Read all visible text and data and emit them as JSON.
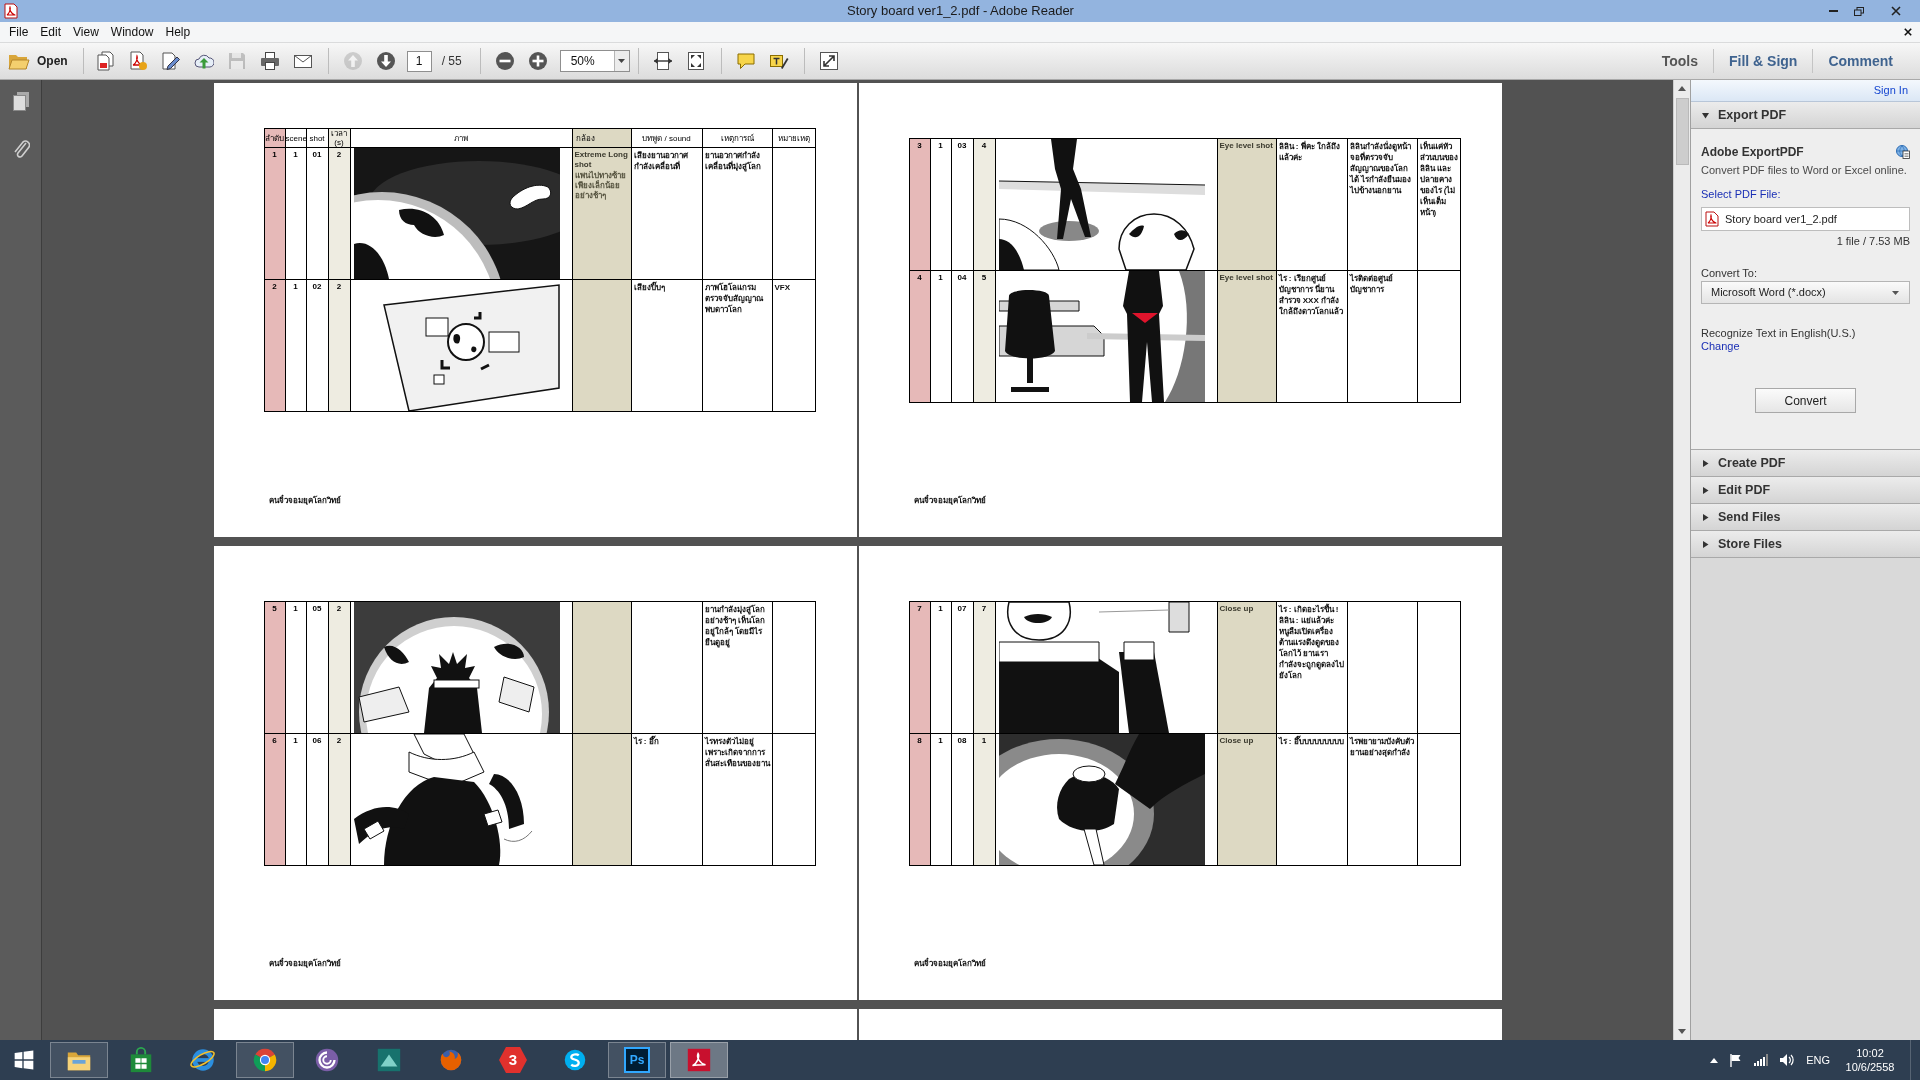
{
  "window": {
    "title": "Story board ver1_2.pdf - Adobe Reader"
  },
  "menu": [
    "File",
    "Edit",
    "View",
    "Window",
    "Help"
  ],
  "toolbar": {
    "open": "Open",
    "buttons": [
      {
        "kind": "create",
        "disabled": false
      },
      {
        "kind": "export",
        "disabled": false
      },
      {
        "kind": "edit",
        "disabled": false
      },
      {
        "kind": "upload",
        "disabled": false
      },
      {
        "kind": "save",
        "disabled": true
      },
      {
        "kind": "print",
        "disabled": false
      },
      {
        "kind": "email",
        "disabled": false
      },
      {
        "kind": "prev",
        "disabled": true
      },
      {
        "kind": "next",
        "disabled": false
      },
      {
        "kind": "zoom_out",
        "disabled": false
      },
      {
        "kind": "zoom_in",
        "disabled": false
      },
      {
        "kind": "fit_width",
        "disabled": false
      },
      {
        "kind": "fit_page",
        "disabled": false
      },
      {
        "kind": "comment",
        "disabled": false
      },
      {
        "kind": "highlight",
        "disabled": false
      },
      {
        "kind": "fullscreen",
        "disabled": false
      }
    ],
    "page": "1",
    "page_total": "/ 55",
    "zoom": "50%",
    "panes": [
      {
        "label": "Tools",
        "selected": true
      },
      {
        "label": "Fill & Sign",
        "selected": false
      },
      {
        "label": "Comment",
        "selected": false
      }
    ]
  },
  "pages": [
    {
      "header": [
        "ลำดับ",
        "scene",
        "shot",
        "เวลา (s)",
        "ภาพ",
        "กล้อง",
        "บทพูด / sound",
        "เหตุการณ์",
        "หมายเหตุ"
      ],
      "rows": [
        {
          "order": "1",
          "scene": "1",
          "shot": "01",
          "time": "2",
          "camera": "Extreme Long shot",
          "camera_note": "แพนไปทางซ้ายเพียงเล็กน้อยอย่างช้าๆ",
          "sound": "เสียงยานอวกาศกำลังเคลื่อนที่",
          "event": "ยานอวกาศกำลังเคลื่อนที่มุ่งสู่โลก"
        },
        {
          "order": "2",
          "scene": "1",
          "shot": "02",
          "time": "2",
          "sound": "เสียงปิ๊บๆ",
          "event": "ภาพโฮโลแกรมตรวจจับสัญญาณพบดาวโลก",
          "note": "VFX"
        }
      ],
      "footer": "คนจิ๋วจอมยุคโลกวิทย์"
    },
    {
      "rows": [
        {
          "order": "3",
          "scene": "1",
          "shot": "03",
          "time": "4",
          "camera": "Eye level shot",
          "sound": "ลิลิน : พี่คะ ใกล้ถึงแล้วค่ะ",
          "event": "ลิลินกำลังนั่งดูหน้าจอที่ตรวจจับสัญญาณของโลกได้ ไรกำลังยืนมองไปข้างนอกยาน",
          "note": "เห็นแค่หัวส่วนบนของลิลิน และปลายคางของไร (ไม่เห็นเต็มหน้า)"
        },
        {
          "order": "4",
          "scene": "1",
          "shot": "04",
          "time": "5",
          "camera": "Eye level shot",
          "sound": "ไร : เรียกศูนย์บัญชาการ นี่ยานสำรวจ XXX กำลังใกล้ถึงดาวโลกแล้ว",
          "event": "ไรติดต่อศูนย์บัญชาการ"
        }
      ],
      "footer": "คนจิ๋วจอมยุคโลกวิทย์"
    },
    {
      "rows": [
        {
          "order": "5",
          "scene": "1",
          "shot": "05",
          "time": "2",
          "event": "ยานกำลังมุ่งสู่โลกอย่างช้าๆ เห็นโลกอยู่ใกล้ๆ โดยมีไรยืนดูอยู่"
        },
        {
          "order": "6",
          "scene": "1",
          "shot": "06",
          "time": "2",
          "sound": "ไร : อึ๊ก",
          "event": "ไรทรงตัวไม่อยู่เพราะเกิดจากการสั่นสะเทือนของยาน"
        }
      ],
      "footer": "คนจิ๋วจอมยุคโลกวิทย์"
    },
    {
      "rows": [
        {
          "order": "7",
          "scene": "1",
          "shot": "07",
          "time": "7",
          "camera": "Close up",
          "sound": "ไร : เกิดอะไรขึ้น !\nลิลิน : แย่แล้วค่ะ หนูลืมเปิดเครื่องต้านแรงดึงดูดของโลกไว้ ยานเรากำลังจะถูกดูดลงไปยังโลก"
        },
        {
          "order": "8",
          "scene": "1",
          "shot": "08",
          "time": "1",
          "camera": "Close up",
          "sound": "ไร : อึ๊บบบบบบบบบ",
          "event": "ไรพยายามบังคับตัวยานอย่างสุดกำลัง"
        }
      ],
      "footer": "คนจิ๋วจอมยุคโลกวิทย์"
    }
  ],
  "right_panel": {
    "sign_in": "Sign In",
    "sections": [
      {
        "label": "Export PDF",
        "expanded": true,
        "title": "Adobe ExportPDF",
        "description": "Convert PDF files to Word or Excel online.",
        "select_label": "Select PDF File:",
        "file": "Story board ver1_2.pdf",
        "file_info": "1 file / 7.53 MB",
        "convert_label": "Convert To:",
        "convert_to": "Microsoft Word (*.docx)",
        "recognize": "Recognize Text in English(U.S.)",
        "change": "Change",
        "button": "Convert"
      },
      {
        "label": "Create PDF",
        "expanded": false
      },
      {
        "label": "Edit PDF",
        "expanded": false
      },
      {
        "label": "Send Files",
        "expanded": false
      },
      {
        "label": "Store Files",
        "expanded": false
      }
    ]
  },
  "taskbar": {
    "apps": [
      {
        "kind": "folder",
        "running": true,
        "selected": false
      },
      {
        "kind": "bag",
        "running": false,
        "selected": false
      },
      {
        "kind": "ring",
        "running": false,
        "selected": false
      },
      {
        "kind": "segmented",
        "running": true,
        "selected": false
      },
      {
        "kind": "spiral",
        "running": false,
        "selected": false
      },
      {
        "kind": "peak",
        "running": false,
        "selected": false
      },
      {
        "kind": "globe",
        "running": false,
        "selected": false
      },
      {
        "kind": "hexagon",
        "glyph": "3",
        "running": false,
        "selected": false
      },
      {
        "kind": "bubble",
        "running": false,
        "selected": false
      },
      {
        "kind": "tile",
        "glyph": "Ps",
        "running": true,
        "selected": false
      },
      {
        "kind": "swirl",
        "running": true,
        "selected": true
      }
    ],
    "language": "ENG",
    "time": "10:02",
    "date": "10/6/2558"
  }
}
